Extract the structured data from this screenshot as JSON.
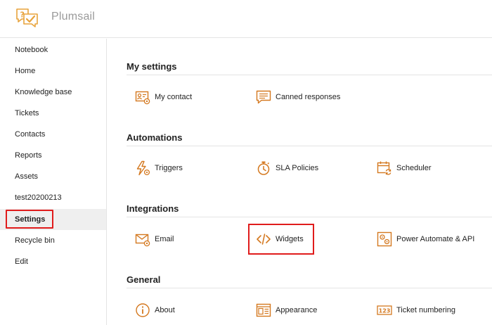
{
  "app": {
    "brand": "Plumsail",
    "accent": "#d4781f"
  },
  "sidebar": {
    "items": [
      {
        "label": "Notebook"
      },
      {
        "label": "Home"
      },
      {
        "label": "Knowledge base"
      },
      {
        "label": "Tickets"
      },
      {
        "label": "Contacts"
      },
      {
        "label": "Reports"
      },
      {
        "label": "Assets"
      },
      {
        "label": "test20200213"
      },
      {
        "label": "Settings",
        "active": true
      },
      {
        "label": "Recycle bin"
      },
      {
        "label": "Edit"
      }
    ]
  },
  "sections": [
    {
      "title": "My settings",
      "tiles": [
        {
          "label": "My contact",
          "icon": "contact-card-gear-icon"
        },
        {
          "label": "Canned responses",
          "icon": "chat-lines-icon"
        }
      ]
    },
    {
      "title": "Automations",
      "tiles": [
        {
          "label": "Triggers",
          "icon": "lightning-gear-icon"
        },
        {
          "label": "SLA Policies",
          "icon": "stopwatch-icon"
        },
        {
          "label": "Scheduler",
          "icon": "calendar-refresh-icon"
        }
      ]
    },
    {
      "title": "Integrations",
      "tiles": [
        {
          "label": "Email",
          "icon": "envelope-gear-icon"
        },
        {
          "label": "Widgets",
          "icon": "code-brackets-icon"
        },
        {
          "label": "Power Automate & API",
          "icon": "gears-box-icon"
        }
      ]
    },
    {
      "title": "General",
      "tiles": [
        {
          "label": "About",
          "icon": "info-circle-icon"
        },
        {
          "label": "Appearance",
          "icon": "layout-window-icon"
        },
        {
          "label": "Ticket numbering",
          "icon": "numbers-123-icon"
        }
      ]
    }
  ]
}
